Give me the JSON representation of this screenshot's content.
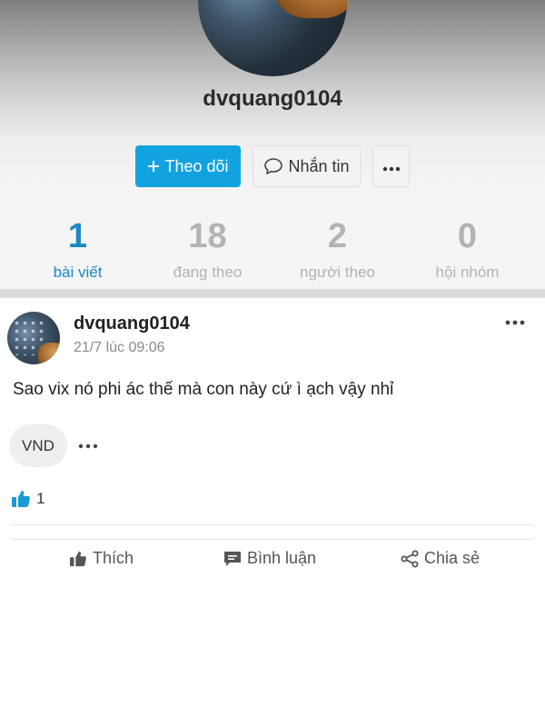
{
  "profile": {
    "username": "dvquang0104",
    "follow_label": "Theo dõi",
    "message_label": "Nhắn tin",
    "more_icon": "ellipsis-icon"
  },
  "stats": [
    {
      "value": "1",
      "label": "bài viết",
      "active": true
    },
    {
      "value": "18",
      "label": "đang theo",
      "active": false
    },
    {
      "value": "2",
      "label": "người theo",
      "active": false
    },
    {
      "value": "0",
      "label": "hội nhóm",
      "active": false
    }
  ],
  "post": {
    "author": "dvquang0104",
    "timestamp": "21/7 lúc 09:06",
    "content": "Sao vix nó phi ác thế mà con này cứ ì ạch vậy nhỉ",
    "tag": "VND",
    "like_count": "1",
    "actions": {
      "like_label": "Thích",
      "comment_label": "Bình luận",
      "share_label": "Chia sẻ"
    }
  },
  "colors": {
    "accent": "#11a3df",
    "stat_active": "#1989c4",
    "stat_inactive": "#b3b3b3"
  }
}
